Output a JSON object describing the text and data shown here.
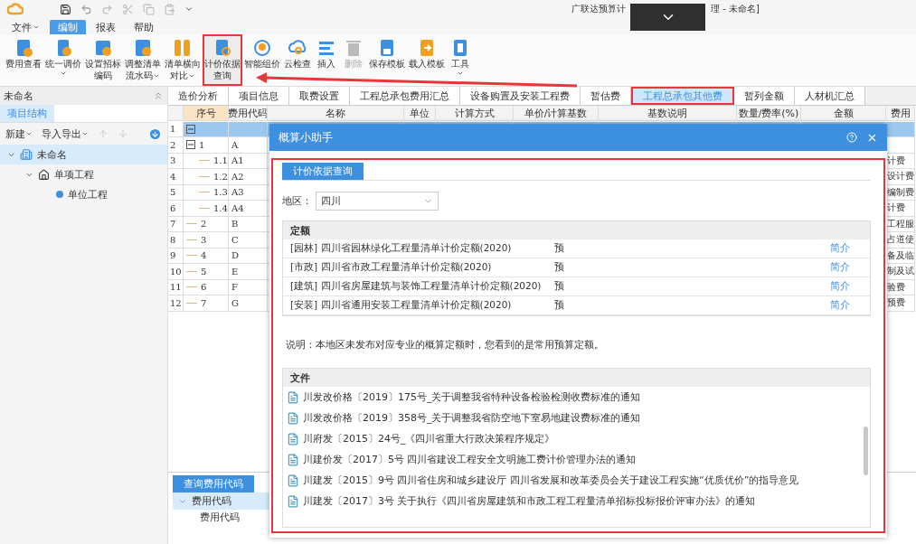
{
  "title_bar": {
    "title_left": "广联达预算计",
    "title_right": "理 - 未命名]"
  },
  "menu": [
    {
      "label": "文件",
      "has_menu": true,
      "selected": false
    },
    {
      "label": "编制",
      "has_menu": false,
      "selected": true
    },
    {
      "label": "报表",
      "has_menu": false,
      "selected": false
    },
    {
      "label": "帮助",
      "has_menu": false,
      "selected": false
    }
  ],
  "ribbon": [
    {
      "lines": [
        "费用查看"
      ],
      "dropdown": false,
      "disabled": false,
      "annotated": false
    },
    {
      "lines": [
        "统一调价"
      ],
      "dropdown": true,
      "disabled": false,
      "annotated": false
    },
    {
      "lines": [
        "设置招标",
        "编码"
      ],
      "dropdown": false,
      "disabled": false,
      "annotated": false
    },
    {
      "lines": [
        "调整清单",
        "流水码"
      ],
      "dropdown": true,
      "disabled": false,
      "annotated": false
    },
    {
      "lines": [
        "清单横向",
        "对比"
      ],
      "dropdown": true,
      "disabled": false,
      "annotated": false
    },
    {
      "lines": [
        "计价依据",
        "查询"
      ],
      "dropdown": false,
      "disabled": false,
      "annotated": true
    },
    {
      "lines": [
        "智能组价"
      ],
      "dropdown": false,
      "disabled": false,
      "annotated": false
    },
    {
      "lines": [
        "云检查"
      ],
      "dropdown": false,
      "disabled": false,
      "annotated": false
    },
    {
      "lines": [
        "插入"
      ],
      "dropdown": false,
      "disabled": false,
      "annotated": false
    },
    {
      "lines": [
        "删除"
      ],
      "dropdown": false,
      "disabled": true,
      "annotated": false
    },
    {
      "lines": [
        "保存模板"
      ],
      "dropdown": false,
      "disabled": false,
      "annotated": false
    },
    {
      "lines": [
        "载入模板"
      ],
      "dropdown": false,
      "disabled": false,
      "annotated": false
    },
    {
      "lines": [
        "工具"
      ],
      "dropdown": true,
      "disabled": false,
      "annotated": false
    }
  ],
  "left_panel": {
    "title": "未命名",
    "tabs": [
      {
        "label": "项目结构",
        "selected": true
      }
    ],
    "toolbar": [
      {
        "label": "新建"
      },
      {
        "label": "导入导出"
      }
    ],
    "tree": [
      {
        "label": "未命名",
        "kind": "project",
        "selected": true,
        "expanded": true,
        "children": [
          {
            "label": "单项工程",
            "kind": "single",
            "selected": false,
            "expanded": true,
            "children": [
              {
                "label": "单位工程",
                "kind": "unit",
                "selected": false
              }
            ]
          }
        ]
      }
    ]
  },
  "tabs": [
    {
      "label": "造价分析",
      "selected": false,
      "annotated": false
    },
    {
      "label": "项目信息",
      "selected": false,
      "annotated": false
    },
    {
      "label": "取费设置",
      "selected": false,
      "annotated": false
    },
    {
      "label": "工程总承包费用汇总",
      "selected": false,
      "annotated": false
    },
    {
      "label": "设备购置及安装工程费",
      "selected": false,
      "annotated": false
    },
    {
      "label": "暂估费",
      "selected": false,
      "annotated": false
    },
    {
      "label": "工程总承包其他费",
      "selected": true,
      "annotated": true
    },
    {
      "label": "暂列金额",
      "selected": false,
      "annotated": false
    },
    {
      "label": "人材机汇总",
      "selected": false,
      "annotated": false
    }
  ],
  "grid": {
    "columns": [
      {
        "label": "序号",
        "selected": true
      },
      {
        "label": "费用代码",
        "selected": false
      },
      {
        "label": "名称",
        "selected": false
      },
      {
        "label": "单位",
        "selected": false
      },
      {
        "label": "计算方式",
        "selected": false
      },
      {
        "label": "单价/计算基数",
        "selected": false
      },
      {
        "label": "基数说明",
        "selected": false
      },
      {
        "label": "数量/费率(%)",
        "selected": false
      },
      {
        "label": "金额",
        "selected": false
      },
      {
        "label": "费用",
        "selected": false
      }
    ],
    "rows": [
      {
        "num": "1",
        "seq": "",
        "code": "",
        "selected": true,
        "expanded": true,
        "children": [
          {
            "num": "2",
            "seq": "1",
            "code": "A",
            "selected": false,
            "expanded": true,
            "children": [
              {
                "num": "3",
                "seq": "1.1",
                "code": "A1",
                "selected": false,
                "category": "计费"
              },
              {
                "num": "4",
                "seq": "1.2",
                "code": "A2",
                "selected": false,
                "category": "设计费"
              },
              {
                "num": "5",
                "seq": "1.3",
                "code": "A3",
                "selected": false,
                "category": "编制费"
              },
              {
                "num": "6",
                "seq": "1.4",
                "code": "A4",
                "selected": false,
                "category": "计费"
              }
            ]
          },
          {
            "num": "7",
            "seq": "2",
            "code": "B",
            "selected": false,
            "category": "工程服"
          },
          {
            "num": "8",
            "seq": "3",
            "code": "C",
            "selected": false,
            "category": "占道使"
          },
          {
            "num": "9",
            "seq": "4",
            "code": "D",
            "selected": false,
            "category": "备及临"
          },
          {
            "num": "10",
            "seq": "5",
            "code": "E",
            "selected": false,
            "category": "制及试"
          },
          {
            "num": "11",
            "seq": "6",
            "code": "F",
            "selected": false,
            "category": "验费"
          },
          {
            "num": "12",
            "seq": "7",
            "code": "G",
            "selected": false,
            "category": "预费"
          }
        ]
      }
    ]
  },
  "bottom_panel": {
    "tab": "查询费用代码",
    "tree": [
      {
        "label": "费用代码",
        "selected": true,
        "expanded": true,
        "children": [
          {
            "label": "费用代码",
            "selected": false
          }
        ]
      }
    ]
  },
  "dialog": {
    "title": "概算小助手",
    "annotated": true,
    "tabs": [
      {
        "label": "计价依据查询",
        "selected": true
      }
    ],
    "region_label": "地区：",
    "region": "四川",
    "quota": {
      "heading": "定额",
      "rows": [
        {
          "name": "[园林] 四川省园林绿化工程量清单计价定额(2020)",
          "type": "预",
          "link": "简介"
        },
        {
          "name": "[市政] 四川省市政工程量清单计价定额(2020)",
          "type": "预",
          "link": "简介"
        },
        {
          "name": "[建筑] 四川省房屋建筑与装饰工程量清单计价定额(2020)",
          "type": "预",
          "link": "简介"
        },
        {
          "name": "[安装] 四川省通用安装工程量清单计价定额(2020)",
          "type": "预",
          "link": "简介"
        }
      ]
    },
    "note": "说明：本地区未发布对应专业的概算定额时，您看到的是常用预算定额。",
    "files": {
      "heading": "文件",
      "items": [
        "川发改价格〔2019〕175号_关于调整我省特种设备检验检测收费标准的通知",
        "川发改价格〔2019〕358号_关于调整我省防空地下室易地建设费标准的通知",
        "川府发〔2015〕24号_《四川省重大行政决策程序规定》",
        "川建价发〔2017〕5号 四川省建设工程安全文明施工费计价管理办法的通知",
        "川建发〔2015〕9号 四川省住房和城乡建设厅 四川省发展和改革委员会关于建设工程实施“优质优价”的指导意见",
        "川建发〔2017〕3号 关于执行《四川省房屋建筑和市政工程工程量清单招标投标报价评审办法》的通知"
      ]
    }
  }
}
